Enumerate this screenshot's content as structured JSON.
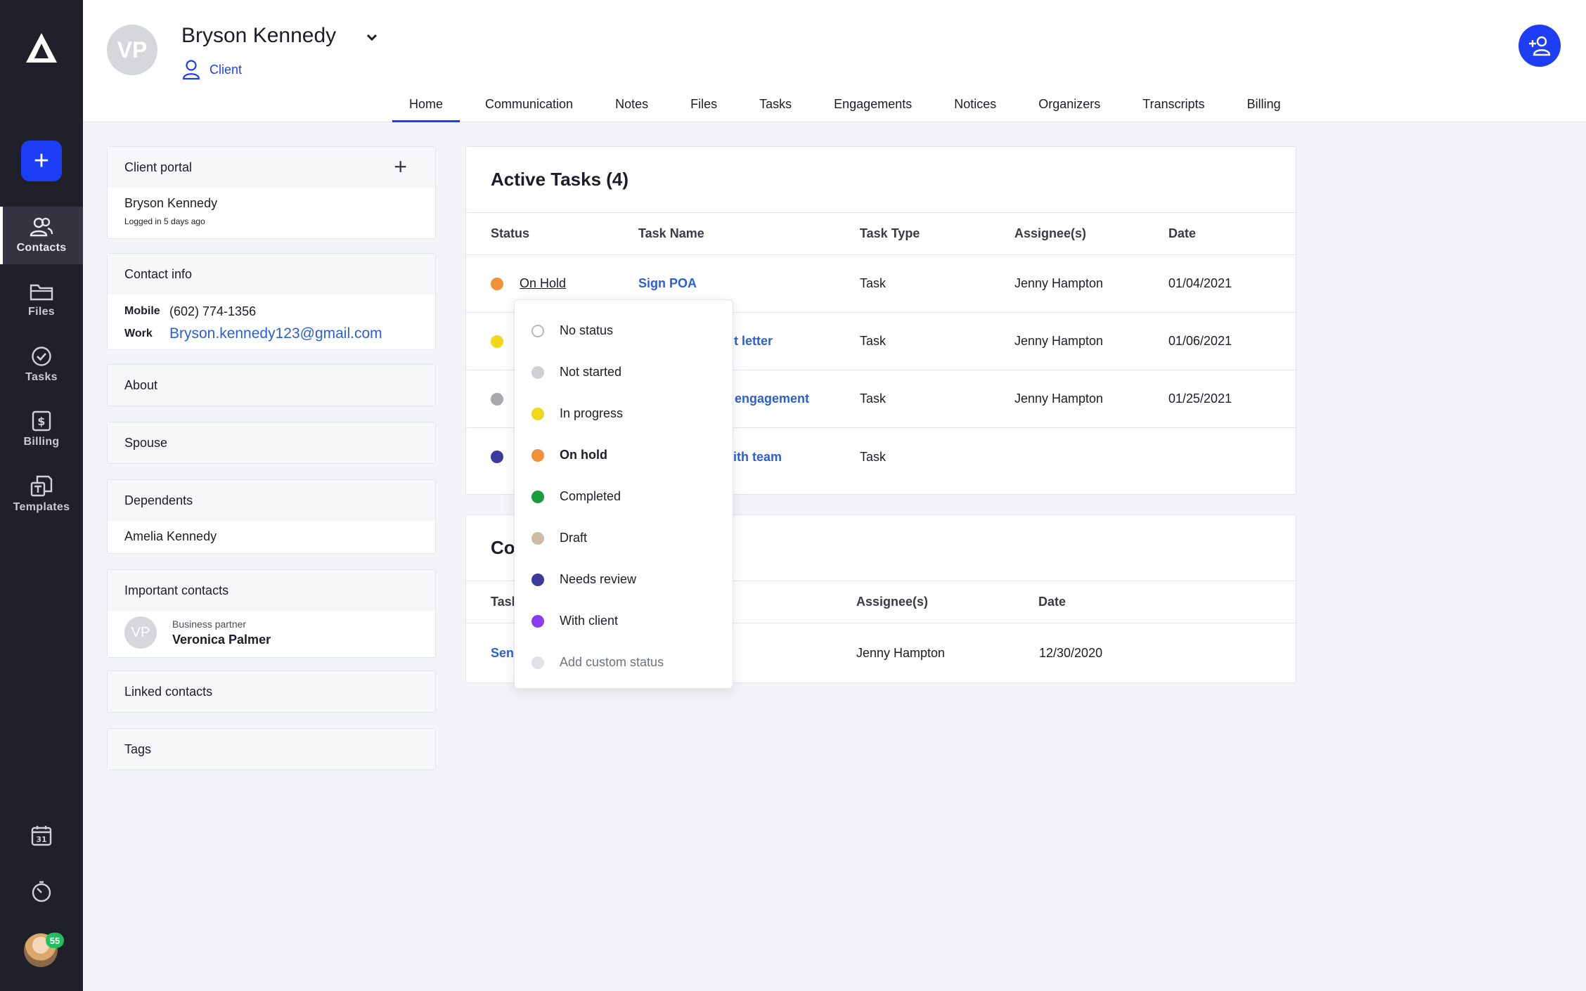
{
  "sidebar": {
    "nav": [
      {
        "label": "Contacts",
        "icon": "contacts-icon",
        "active": true
      },
      {
        "label": "Files",
        "icon": "folder-icon"
      },
      {
        "label": "Tasks",
        "icon": "check-circle-icon"
      },
      {
        "label": "Billing",
        "icon": "dollar-icon"
      },
      {
        "label": "Templates",
        "icon": "templates-icon"
      }
    ],
    "notification_count": "55"
  },
  "header": {
    "avatar_initials": "VP",
    "client_name": "Bryson Kennedy",
    "client_type": "Client",
    "tabs": [
      "Home",
      "Communication",
      "Notes",
      "Files",
      "Tasks",
      "Engagements",
      "Notices",
      "Organizers",
      "Transcripts",
      "Billing"
    ],
    "active_tab": "Home"
  },
  "panels": {
    "client_portal": {
      "title": "Client portal",
      "name": "Bryson Kennedy",
      "note": "Logged in 5 days ago"
    },
    "contact_info": {
      "title": "Contact info",
      "mobile_label": "Mobile",
      "mobile": "(602) 774-1356",
      "work_label": "Work",
      "email": "Bryson.kennedy123@gmail.com"
    },
    "about": {
      "title": "About"
    },
    "spouse": {
      "title": "Spouse"
    },
    "dependents": {
      "title": "Dependents",
      "items": [
        "Amelia Kennedy"
      ]
    },
    "important_contacts": {
      "title": "Important contacts",
      "initials": "VP",
      "role": "Business partner",
      "name": "Veronica Palmer"
    },
    "linked_contacts": {
      "title": "Linked contacts"
    },
    "tags": {
      "title": "Tags"
    }
  },
  "active_tasks": {
    "title": "Active Tasks (4)",
    "columns": [
      "Status",
      "Task Name",
      "Task Type",
      "Assignee(s)",
      "Date"
    ],
    "rows": [
      {
        "status": "On Hold",
        "status_color": "#f0913a",
        "task": "Sign POA",
        "type": "Task",
        "assignee": "Jenny Hampton",
        "date": "01/04/2021"
      },
      {
        "status": "",
        "status_color": "#f2d61c",
        "task": "nt letter",
        "type": "Task",
        "assignee": "Jenny Hampton",
        "date": "01/06/2021"
      },
      {
        "status": "",
        "status_color": "#a8a9ae",
        "task": "r engagement",
        "type": "Task",
        "assignee": "Jenny Hampton",
        "date": "01/25/2021"
      },
      {
        "status": "",
        "status_color": "#3d3a9e",
        "task": "vith team",
        "type": "Task",
        "assignee": "",
        "date": ""
      }
    ]
  },
  "completed_tasks": {
    "title": "Co",
    "columns": [
      "Tasl",
      "Assignee(s)",
      "Date"
    ],
    "rows": [
      {
        "task": "Sen",
        "assignee": "Jenny Hampton",
        "date": "12/30/2020"
      }
    ]
  },
  "status_dropdown": {
    "options": [
      {
        "label": "No status",
        "color": "none"
      },
      {
        "label": "Not started",
        "color": "#cfd0d4"
      },
      {
        "label": "In progress",
        "color": "#f2d61c"
      },
      {
        "label": "On hold",
        "color": "#f0913a",
        "selected": true
      },
      {
        "label": "Completed",
        "color": "#1a9c3d"
      },
      {
        "label": "Draft",
        "color": "#cdbba6"
      },
      {
        "label": "Needs review",
        "color": "#3d3a9e"
      },
      {
        "label": "With client",
        "color": "#8a3cf0"
      },
      {
        "label": "Add custom status",
        "color": "#e1e2e6",
        "muted": true
      }
    ]
  }
}
